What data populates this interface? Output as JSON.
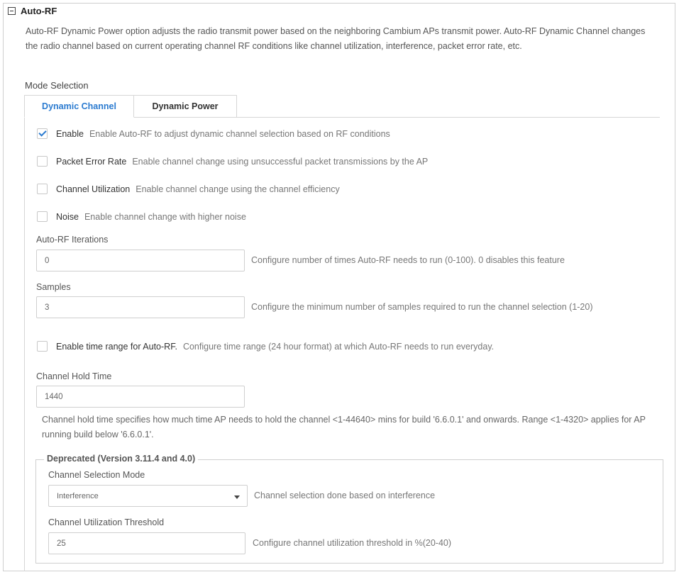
{
  "section": {
    "title": "Auto-RF",
    "description": "Auto-RF Dynamic Power option adjusts the radio transmit power based on the neighboring Cambium APs transmit power. Auto-RF Dynamic Channel changes the radio channel based on current operating channel RF conditions like channel utilization, interference, packet error rate, etc.",
    "mode_label": "Mode Selection"
  },
  "tabs": [
    {
      "label": "Dynamic Channel",
      "active": true
    },
    {
      "label": "Dynamic Power",
      "active": false
    }
  ],
  "checkboxes": [
    {
      "label": "Enable",
      "help": "Enable Auto-RF to adjust dynamic channel selection based on RF conditions",
      "checked": true
    },
    {
      "label": "Packet Error Rate",
      "help": "Enable channel change using unsuccessful packet transmissions by the AP",
      "checked": false
    },
    {
      "label": "Channel Utilization",
      "help": "Enable channel change using the channel efficiency",
      "checked": false
    },
    {
      "label": "Noise",
      "help": "Enable channel change with higher noise",
      "checked": false
    }
  ],
  "iterations": {
    "label": "Auto-RF Iterations",
    "value": "0",
    "help": "Configure number of times Auto-RF needs to run (0-100). 0 disables this feature"
  },
  "samples": {
    "label": "Samples",
    "value": "3",
    "help": "Configure the minimum number of samples required to run the channel selection (1-20)"
  },
  "time_range": {
    "label": "Enable time range for Auto-RF.",
    "help": "Configure time range (24 hour format) at which Auto-RF needs to run everyday.",
    "checked": false
  },
  "hold_time": {
    "label": "Channel Hold Time",
    "value": "1440",
    "description": "Channel hold time specifies how much time AP needs to hold the channel <1-44640> mins for build '6.6.0.1' and onwards. Range <1-4320> applies for AP running build below '6.6.0.1'."
  },
  "deprecated": {
    "legend": "Deprecated (Version 3.11.4 and 4.0)",
    "selection_mode_label": "Channel Selection Mode",
    "selection_mode_value": "Interference",
    "selection_mode_help": "Channel selection done based on interference",
    "threshold_label": "Channel Utilization Threshold",
    "threshold_value": "25",
    "threshold_help": "Configure channel utilization threshold in %(20-40)"
  }
}
